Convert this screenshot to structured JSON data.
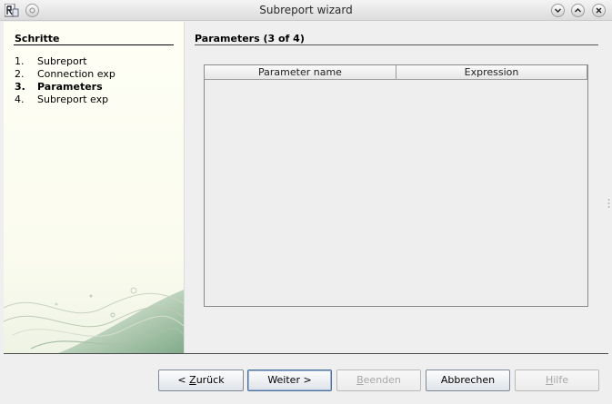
{
  "window": {
    "title": "Subreport wizard"
  },
  "icons": {
    "app": "report-app-icon",
    "menu": "window-menu-icon",
    "minimize": "minimize-icon",
    "maximize": "maximize-icon",
    "close": "close-icon"
  },
  "sidebar": {
    "heading": "Schritte",
    "steps": [
      {
        "num": "1.",
        "label": "Subreport",
        "active": false
      },
      {
        "num": "2.",
        "label": "Connection exp",
        "active": false
      },
      {
        "num": "3.",
        "label": "Parameters",
        "active": true
      },
      {
        "num": "4.",
        "label": "Subreport exp",
        "active": false
      }
    ]
  },
  "main": {
    "title": "Parameters  (3 of 4)",
    "table": {
      "columns": [
        "Parameter name",
        "Expression"
      ],
      "rows": []
    }
  },
  "buttons": {
    "back": {
      "prefix": "< ",
      "mnemonic": "Z",
      "rest": "urück",
      "enabled": true
    },
    "next": {
      "label": "Weiter >",
      "enabled": true,
      "default": true
    },
    "finish": {
      "mnemonic": "B",
      "rest": "eenden",
      "enabled": false
    },
    "cancel": {
      "label": "Abbrechen",
      "enabled": true
    },
    "help": {
      "mnemonic": "H",
      "rest": "ilfe",
      "enabled": false
    }
  }
}
